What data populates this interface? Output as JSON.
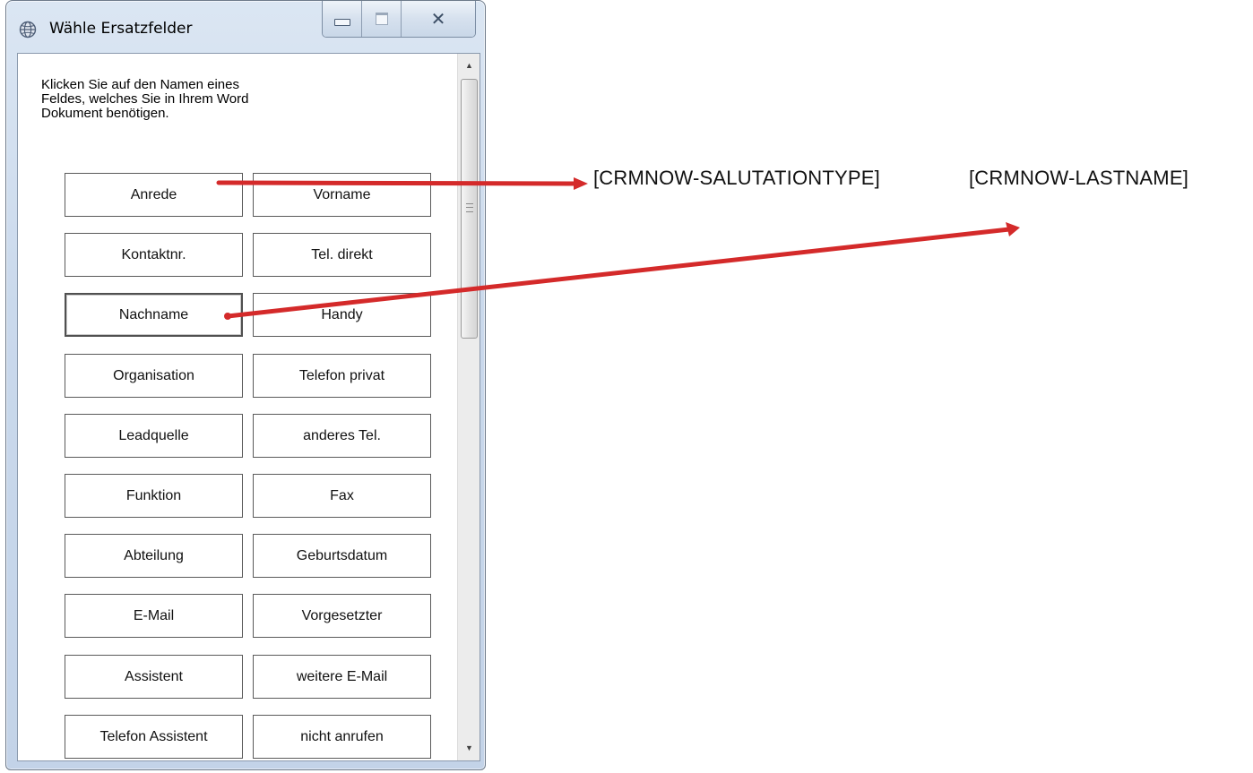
{
  "window": {
    "title": "Wähle Ersatzfelder",
    "close_glyph": "✕"
  },
  "instructions": "Klicken Sie auf den Namen eines\nFeldes, welches Sie in Ihrem Word\nDokument benötigen.",
  "fields": [
    [
      "Anrede",
      "Vorname"
    ],
    [
      "Kontaktnr.",
      "Tel. direkt"
    ],
    [
      "Nachname",
      "Handy"
    ],
    [
      "Organisation",
      "Telefon privat"
    ],
    [
      "Leadquelle",
      "anderes Tel."
    ],
    [
      "Funktion",
      "Fax"
    ],
    [
      "Abteilung",
      "Geburtsdatum"
    ],
    [
      "E-Mail",
      "Vorgesetzter"
    ],
    [
      "Assistent",
      "weitere E-Mail"
    ],
    [
      "Telefon Assistent",
      "nicht anrufen"
    ]
  ],
  "focused_field": "Nachname",
  "scrollbar": {
    "up_arrow": "▲",
    "down_arrow": "▼"
  },
  "placeholders": {
    "salutation": "[CRMNOW-SALUTATIONTYPE]",
    "lastname": "[CRMNOW-LASTNAME]"
  },
  "colors": {
    "arrow": "#d42a2a",
    "window_frame": "#c3d3e8"
  }
}
